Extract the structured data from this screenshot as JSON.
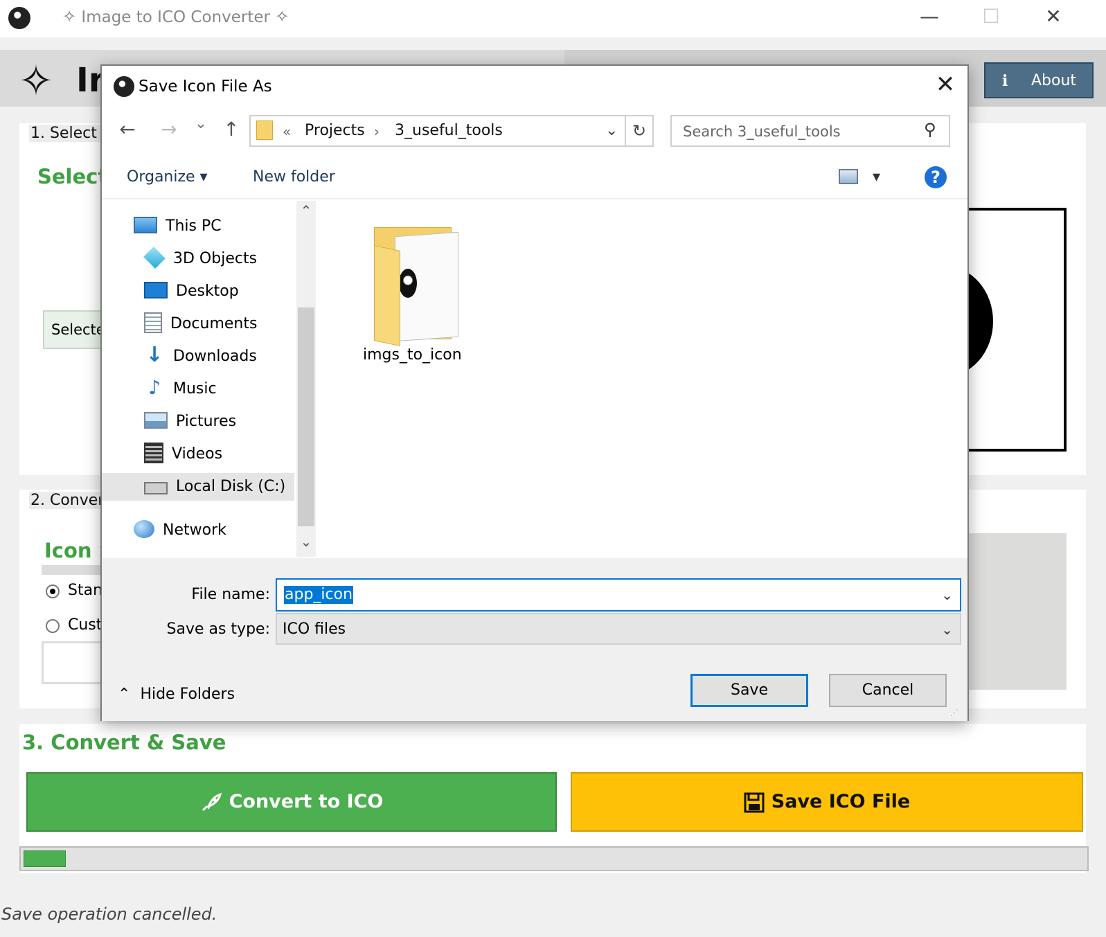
{
  "window": {
    "title": "Image to ICO Converter",
    "title_glyph": "✧",
    "minimize": "—",
    "maximize": "☐",
    "close": "✕"
  },
  "app": {
    "title_partial": "Ir",
    "about_icon": "i",
    "about_label": "About",
    "panel1_label": "1. Select I",
    "select_heading": "Select",
    "selected_text": "Selecte",
    "panel2_label": "2. Conver",
    "icon_size_heading": "Icon S",
    "radio_standard": "Stan",
    "radio_custom": "Cust",
    "convert_heading": "3. Convert & Save",
    "convert_button": "Convert to ICO",
    "save_button": "Save ICO File",
    "progress_fraction": 0.04,
    "status": "Save operation cancelled.",
    "colors": {
      "green": "#4caf50",
      "amber": "#ffc107",
      "about": "#4e6e88"
    }
  },
  "dialog": {
    "title": "Save Icon File As",
    "close_glyph": "✕",
    "back_glyph": "←",
    "forward_glyph": "→",
    "recent_glyph": "⌄",
    "up_glyph": "↑",
    "breadcrumb": {
      "overflow": "«",
      "items": [
        "Projects",
        "3_useful_tools"
      ],
      "separator": "›",
      "dropdown_glyph": "⌄"
    },
    "refresh_glyph": "↻",
    "search_placeholder": "Search 3_useful_tools",
    "search_icon": "⚲",
    "organize": "Organize ▾",
    "new_folder": "New folder",
    "view_dropdown": "▾",
    "help": "?",
    "nav_items": [
      {
        "label": "This PC",
        "icon": "this-pc-icon"
      },
      {
        "label": "3D Objects",
        "icon": "3d-objects-icon"
      },
      {
        "label": "Desktop",
        "icon": "desktop-icon"
      },
      {
        "label": "Documents",
        "icon": "documents-icon"
      },
      {
        "label": "Downloads",
        "icon": "downloads-icon"
      },
      {
        "label": "Music",
        "icon": "music-icon"
      },
      {
        "label": "Pictures",
        "icon": "pictures-icon"
      },
      {
        "label": "Videos",
        "icon": "videos-icon"
      },
      {
        "label": "Local Disk (C:)",
        "icon": "local-disk-icon",
        "selected": true
      },
      {
        "label": "Network",
        "icon": "network-icon"
      }
    ],
    "scroll_up": "⌃",
    "scroll_down": "⌄",
    "files": [
      {
        "name": "imgs_to_icon",
        "type": "folder"
      }
    ],
    "file_name_label": "File name:",
    "file_name_value": "app_icon",
    "save_as_type_label": "Save as type:",
    "save_as_type_value": "ICO files",
    "hide_folders_glyph": "⌃",
    "hide_folders": "Hide Folders",
    "save": "Save",
    "cancel": "Cancel",
    "dropdown_glyph": "⌄"
  }
}
